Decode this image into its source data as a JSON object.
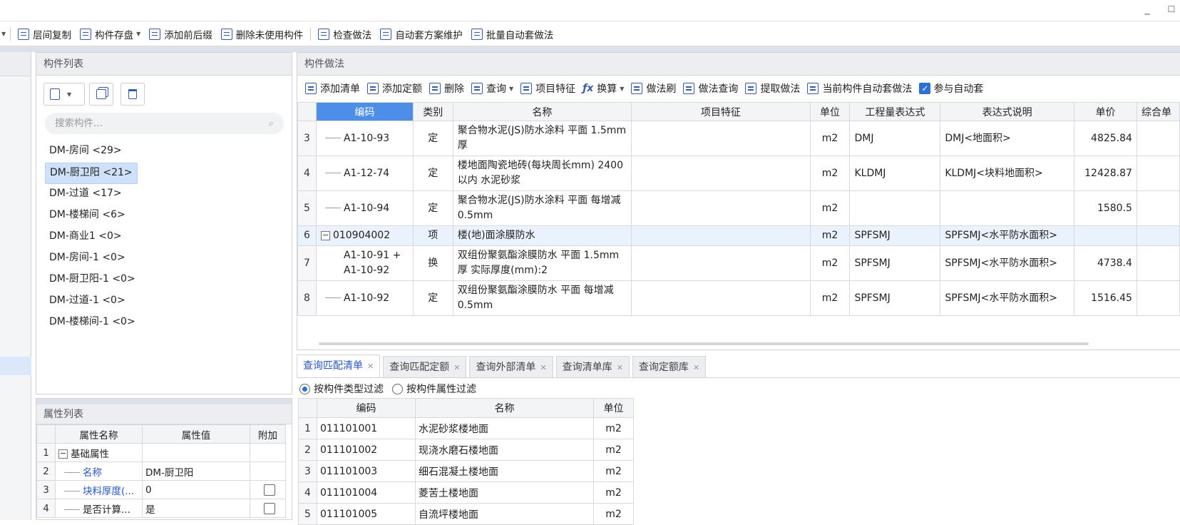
{
  "window": {
    "minimize_icon": "minimize-icon",
    "maximize_icon": "maximize-icon"
  },
  "toolbar": {
    "items": [
      {
        "label": "层间复制",
        "icon": "copy-layers-icon"
      },
      {
        "label": "构件存盘",
        "icon": "save-component-icon",
        "dropdown": true
      },
      {
        "label": "添加前后缀",
        "icon": "add-affix-icon"
      },
      {
        "label": "删除未使用构件",
        "icon": "delete-unused-icon"
      },
      {
        "label": "检查做法",
        "icon": "check-method-icon"
      },
      {
        "label": "自动套方案维护",
        "icon": "auto-scheme-icon"
      },
      {
        "label": "批量自动套做法",
        "icon": "batch-auto-icon"
      }
    ]
  },
  "component_panel": {
    "title": "构件列表",
    "search_placeholder": "搜索构件...",
    "items": [
      {
        "label": "DM-房间 <29>",
        "selected": false
      },
      {
        "label": "DM-厨卫阳 <21>",
        "selected": true
      },
      {
        "label": "DM-过道 <17>",
        "selected": false
      },
      {
        "label": "DM-楼梯间 <6>",
        "selected": false
      },
      {
        "label": "DM-商业1 <0>",
        "selected": false
      },
      {
        "label": "DM-房间-1 <0>",
        "selected": false
      },
      {
        "label": "DM-厨卫阳-1 <0>",
        "selected": false
      },
      {
        "label": "DM-过道-1 <0>",
        "selected": false
      },
      {
        "label": "DM-楼梯间-1 <0>",
        "selected": false
      }
    ]
  },
  "property_panel": {
    "title": "属性列表",
    "headers": [
      "属性名称",
      "属性值",
      "附加"
    ],
    "rows": [
      {
        "n": "1",
        "name": "基础属性",
        "value": "",
        "group": true
      },
      {
        "n": "2",
        "name": "名称",
        "value": "DM-厨卫阳"
      },
      {
        "n": "3",
        "name": "块料厚度(...",
        "value": "0",
        "checkbox": true
      },
      {
        "n": "4",
        "name": "是否计算...",
        "value": "是",
        "checkbox": true
      }
    ]
  },
  "method_panel": {
    "title": "构件做法",
    "toolbar": [
      {
        "label": "添加清单"
      },
      {
        "label": "添加定额"
      },
      {
        "label": "删除"
      },
      {
        "label": "查询",
        "dropdown": true
      },
      {
        "label": "项目特征"
      },
      {
        "label": "换算",
        "dropdown": true
      },
      {
        "label": "做法刷"
      },
      {
        "label": "做法查询"
      },
      {
        "label": "提取做法"
      },
      {
        "label": "当前构件自动套做法"
      }
    ],
    "auto_checkbox_label": "参与自动套",
    "headers": [
      "编码",
      "类别",
      "名称",
      "项目特征",
      "单位",
      "工程量表达式",
      "表达式说明",
      "单价",
      "综合单"
    ],
    "rows": [
      {
        "n": "3",
        "code": "A1-10-93",
        "type": "定",
        "name": "聚合物水泥(JS)防水涂料 平面 1.5mm厚",
        "feature": "",
        "unit": "m2",
        "expr": "DMJ",
        "desc": "DMJ<地面积>",
        "price": "4825.84"
      },
      {
        "n": "4",
        "code": "A1-12-74",
        "type": "定",
        "name": "楼地面陶瓷地砖(每块周长mm) 2400以内 水泥砂浆",
        "feature": "",
        "unit": "m2",
        "expr": "KLDMJ",
        "desc": "KLDMJ<块料地面积>",
        "price": "12428.87"
      },
      {
        "n": "5",
        "code": "A1-10-94",
        "type": "定",
        "name": "聚合物水泥(JS)防水涂料 平面 每增减0.5mm",
        "feature": "",
        "unit": "m2",
        "expr": "",
        "desc": "",
        "price": "1580.5"
      },
      {
        "n": "6",
        "code": "010904002",
        "type": "项",
        "name": "楼(地)面涂膜防水",
        "feature": "",
        "unit": "m2",
        "expr": "SPFSMJ",
        "desc": "SPFSMJ<水平防水面积>",
        "price": ""
      },
      {
        "n": "7",
        "code": "A1-10-91 + A1-10-92",
        "type": "换",
        "name": "双组份聚氨酯涂膜防水 平面 1.5mm厚  实际厚度(mm):2",
        "feature": "",
        "unit": "m2",
        "expr": "SPFSMJ",
        "desc": "SPFSMJ<水平防水面积>",
        "price": "4738.4"
      },
      {
        "n": "8",
        "code": "A1-10-92",
        "type": "定",
        "name": "双组份聚氨酯涂膜防水 平面 每增减0.5mm",
        "feature": "",
        "unit": "m2",
        "expr": "SPFSMJ",
        "desc": "SPFSMJ<水平防水面积>",
        "price": "1516.45"
      }
    ]
  },
  "query_tabs": [
    "查询匹配清单",
    "查询匹配定额",
    "查询外部清单",
    "查询清单库",
    "查询定额库"
  ],
  "filters": [
    "按构件类型过滤",
    "按构件属性过滤"
  ],
  "query_table": {
    "headers": [
      "编码",
      "名称",
      "单位"
    ],
    "rows": [
      {
        "n": "1",
        "code": "011101001",
        "name": "水泥砂浆楼地面",
        "unit": "m2"
      },
      {
        "n": "2",
        "code": "011101002",
        "name": "现浇水磨石楼地面",
        "unit": "m2"
      },
      {
        "n": "3",
        "code": "011101003",
        "name": "细石混凝土楼地面",
        "unit": "m2"
      },
      {
        "n": "4",
        "code": "011101004",
        "name": "菱苦土楼地面",
        "unit": "m2"
      },
      {
        "n": "5",
        "code": "011101005",
        "name": "自流坪楼地面",
        "unit": "m2"
      }
    ]
  }
}
